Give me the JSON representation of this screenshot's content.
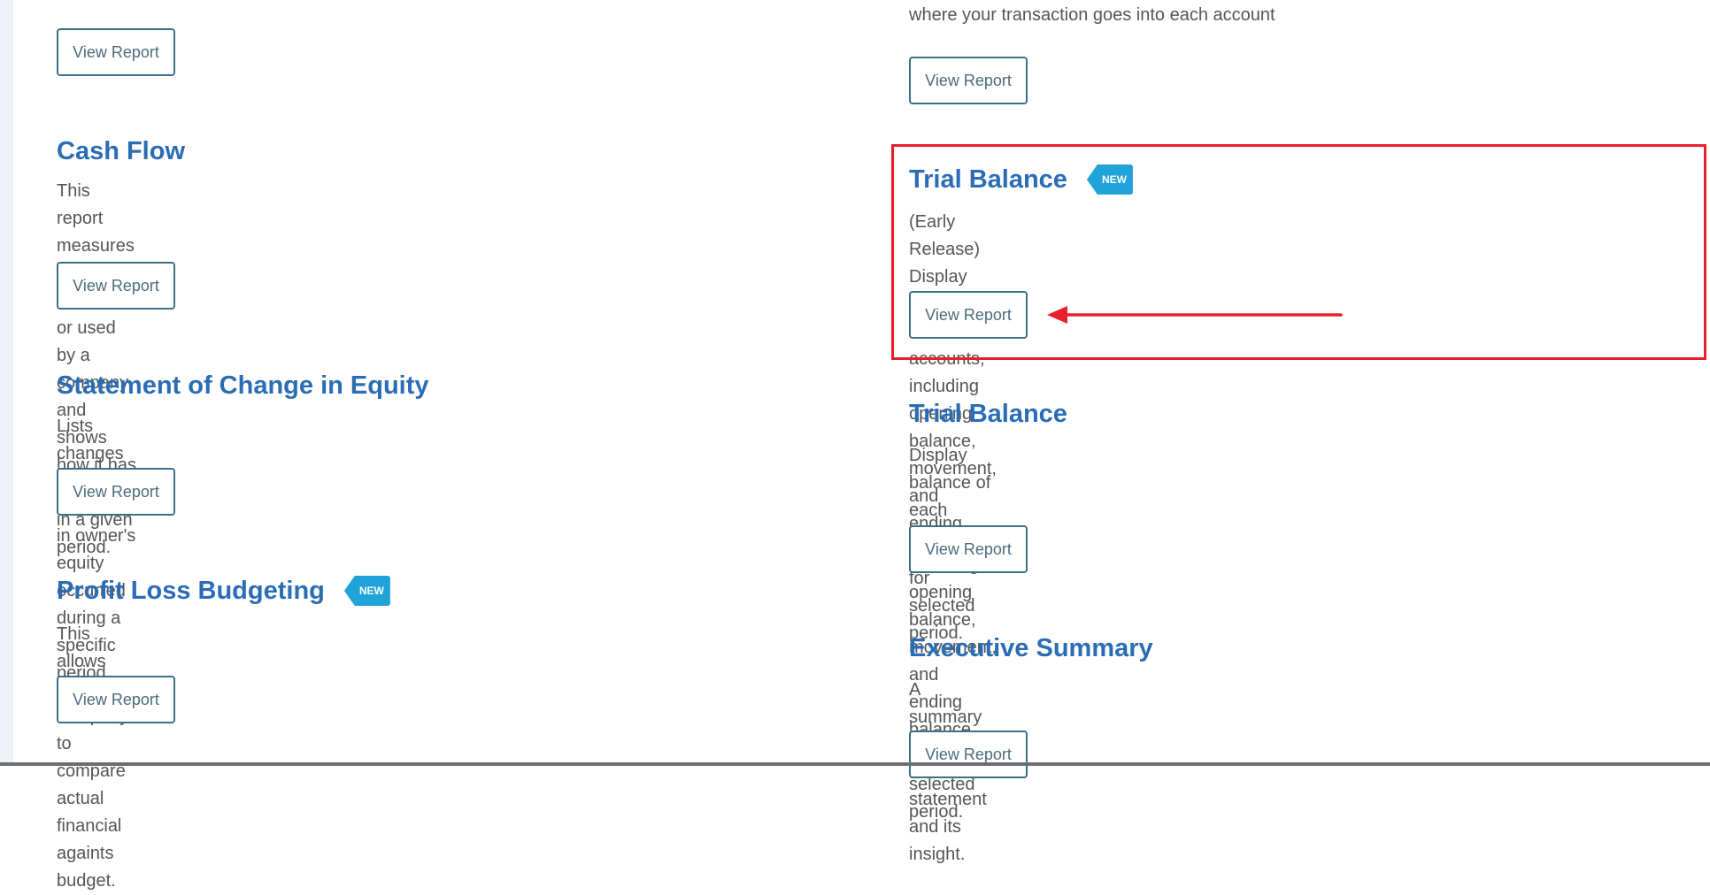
{
  "page": {
    "top_cut_text": "where your transaction goes into each account",
    "colors": {
      "title": "#2a6db5",
      "badge": "#1fa3d8",
      "button_border": "#3d6e8a",
      "highlight": "#e8202a"
    }
  },
  "left_column": {
    "top_button_label": "View Report",
    "reports": [
      {
        "title": "Cash Flow",
        "badge": null,
        "description_lines": [
          "This report measures the cash generated or used by a company and shows how it has moved",
          "in a given period."
        ],
        "button_label": "View Report"
      },
      {
        "title": "Statement of Change in Equity",
        "badge": null,
        "description_lines": [
          "Lists changes or movement in owner's equity occurred during a specific period."
        ],
        "button_label": "View Report"
      },
      {
        "title": "Profit Loss Budgeting",
        "badge": "NEW",
        "description_lines": [
          "This allows the company to compare actual financial againts budget."
        ],
        "button_label": "View Report"
      }
    ]
  },
  "right_column": {
    "top_description": "where your transaction goes into each account",
    "top_button_label": "View Report",
    "reports": [
      {
        "title": "Trial Balance",
        "badge": "NEW",
        "highlighted": true,
        "description_lines": [
          "(Early Release) Display balance of each accounts, including opening balance, movement, and",
          "ending balance for selected period."
        ],
        "button_label": "View Report"
      },
      {
        "title": "Trial Balance",
        "badge": null,
        "highlighted": false,
        "description_lines": [
          "Display balance of each accounts, including opening balance, movement, and ending balance",
          "for selected period."
        ],
        "button_label": "View Report"
      },
      {
        "title": "Executive Summary",
        "badge": null,
        "highlighted": false,
        "description_lines": [
          "A summary of financial statement and its insight."
        ],
        "button_label": "View Report"
      }
    ]
  },
  "annotation": {
    "type": "red-box-with-arrow",
    "target": "trial-balance-new-view-report-button"
  }
}
